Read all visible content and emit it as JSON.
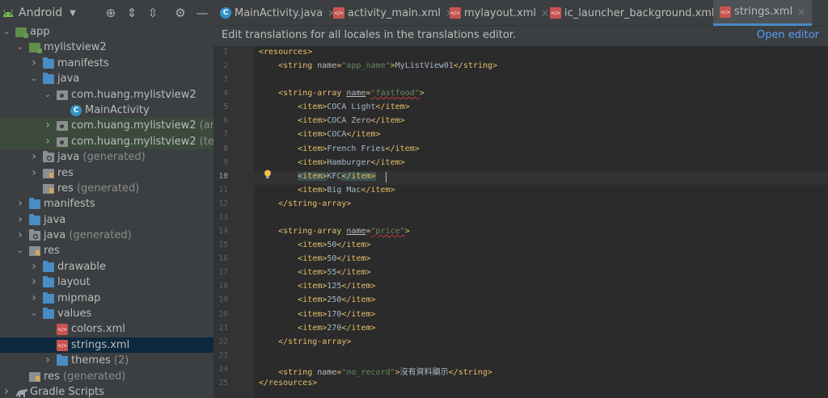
{
  "project_panel": {
    "view_mode": "Android",
    "tree": [
      {
        "label": "app",
        "suffix": "",
        "icon": "module-folder-icon",
        "expanded": true
      },
      {
        "label": "mylistview2",
        "suffix": "",
        "icon": "module-folder-icon",
        "expanded": true
      },
      {
        "label": "manifests",
        "suffix": "",
        "icon": "folder-icon",
        "expanded": false
      },
      {
        "label": "java",
        "suffix": "",
        "icon": "folder-icon",
        "expanded": true
      },
      {
        "label": "com.huang.mylistview2",
        "suffix": "",
        "icon": "package-icon",
        "expanded": true
      },
      {
        "label": "MainActivity",
        "suffix": "",
        "icon": "class-icon",
        "expanded": null
      },
      {
        "label": "com.huang.mylistview2",
        "suffix": "(andro",
        "icon": "package-icon",
        "expanded": false
      },
      {
        "label": "com.huang.mylistview2",
        "suffix": "(test)",
        "icon": "package-icon",
        "expanded": false
      },
      {
        "label": "java",
        "suffix": "(generated)",
        "icon": "generated-folder-icon",
        "expanded": false
      },
      {
        "label": "res",
        "suffix": "",
        "icon": "res-folder-icon",
        "expanded": false
      },
      {
        "label": "res",
        "suffix": "(generated)",
        "icon": "res-folder-icon",
        "expanded": null
      },
      {
        "label": "manifests",
        "suffix": "",
        "icon": "folder-icon",
        "expanded": false
      },
      {
        "label": "java",
        "suffix": "",
        "icon": "folder-icon",
        "expanded": false
      },
      {
        "label": "java",
        "suffix": "(generated)",
        "icon": "generated-folder-icon",
        "expanded": false
      },
      {
        "label": "res",
        "suffix": "",
        "icon": "res-folder-icon",
        "expanded": true
      },
      {
        "label": "drawable",
        "suffix": "",
        "icon": "folder-icon",
        "expanded": false
      },
      {
        "label": "layout",
        "suffix": "",
        "icon": "folder-icon",
        "expanded": false
      },
      {
        "label": "mipmap",
        "suffix": "",
        "icon": "folder-icon",
        "expanded": false
      },
      {
        "label": "values",
        "suffix": "",
        "icon": "folder-icon",
        "expanded": true
      },
      {
        "label": "colors.xml",
        "suffix": "",
        "icon": "xml-file-icon",
        "expanded": null
      },
      {
        "label": "strings.xml",
        "suffix": "",
        "icon": "xml-file-icon",
        "expanded": null
      },
      {
        "label": "themes",
        "suffix": "(2)",
        "icon": "folder-icon",
        "expanded": false
      },
      {
        "label": "res",
        "suffix": "(generated)",
        "icon": "res-folder-icon",
        "expanded": null
      },
      {
        "label": "Gradle Scripts",
        "suffix": "",
        "icon": "gradle-icon",
        "expanded": false
      }
    ]
  },
  "tabs": [
    {
      "label": "MainActivity.java",
      "icon": "java-class-icon",
      "active": false
    },
    {
      "label": "activity_main.xml",
      "icon": "xml-file-icon",
      "active": false
    },
    {
      "label": "mylayout.xml",
      "icon": "xml-file-icon",
      "active": false
    },
    {
      "label": "ic_launcher_background.xml",
      "icon": "xml-file-icon",
      "active": false
    },
    {
      "label": "strings.xml",
      "icon": "xml-file-icon",
      "active": true
    }
  ],
  "tab_close_glyph": "×",
  "notice": {
    "text": "Edit translations for all locales in the translations editor.",
    "link": "Open editor"
  },
  "editor": {
    "current_line": 10,
    "lines": [
      "<resources>",
      "    <string name=\"app_name\">MyListView01</string>",
      "",
      "    <string-array name=\"fastfood\">",
      "        <item>COCA Light</item>",
      "        <item>COCA Zero</item>",
      "        <item>COCA</item>",
      "        <item>French Fries</item>",
      "        <item>Hamburger</item>",
      "        <item>KFC</item>",
      "        <item>Big Mac</item>",
      "    </string-array>",
      "",
      "    <string-array name=\"price\">",
      "        <item>50</item>",
      "        <item>50</item>",
      "        <item>55</item>",
      "        <item>125</item>",
      "        <item>250</item>",
      "        <item>170</item>",
      "        <item>270</item>",
      "    </string-array>",
      "",
      "    <string name=\"no_record\">沒有資料顯示</string>",
      "</resources>"
    ]
  },
  "colors": {
    "tag": "#e8bf6a",
    "attribute": "#bababa",
    "attribute_value": "#6a8759",
    "text": "#a9b7c6",
    "selection": "#0d293e",
    "accent": "#4a88c7"
  }
}
